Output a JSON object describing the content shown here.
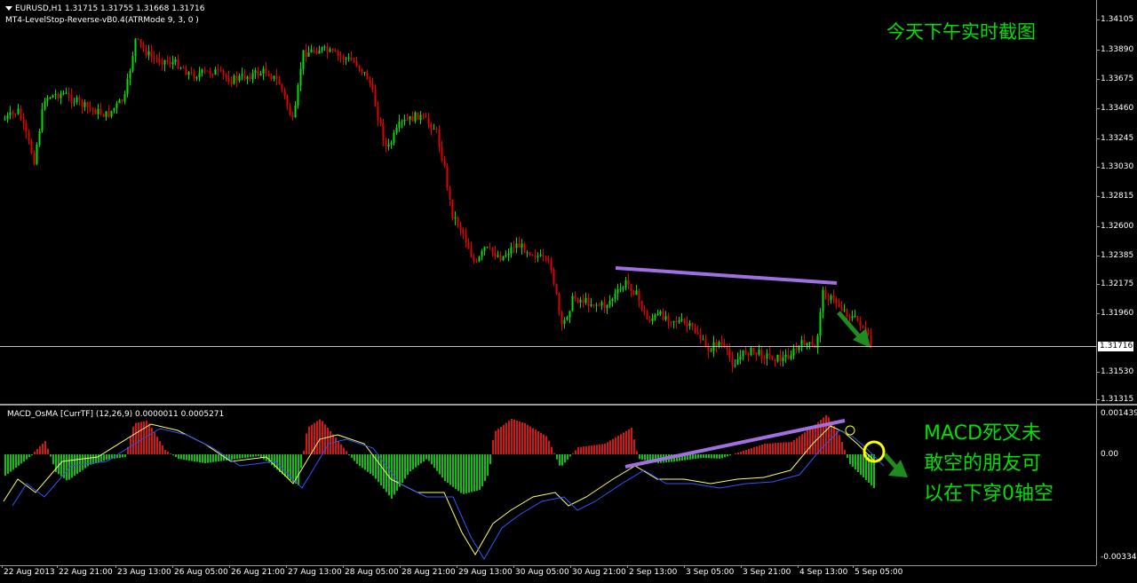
{
  "main": {
    "symbol_line": "EURUSD,H1  1.31715 1.31755 1.31668 1.31716",
    "indicator_line": "MT4-LevelStop-Reverse-vB0.4(ATRMode 9, 3, 0 )",
    "overlay_text": "今天下午实时截图",
    "current_price": "1.31716",
    "price_ticks": [
      "1.34105",
      "1.33890",
      "1.33675",
      "1.33460",
      "1.33245",
      "1.33030",
      "1.32815",
      "1.32600",
      "1.32385",
      "1.32175",
      "1.31960",
      "1.31530",
      "1.31315"
    ]
  },
  "oscillator": {
    "title": "MACD_OsMA [CurrTF] (12,26,9) 0.0000011 0.0005271",
    "ticks": [
      "0.0014391",
      "0.00",
      "-0.0033407"
    ],
    "overlay_lines": [
      "MACD死叉未",
      "敢空的朋友可",
      "以在下穿0轴空"
    ]
  },
  "time_axis": {
    "labels": [
      "22 Aug 2013",
      "22 Aug 21:00",
      "23 Aug 13:00",
      "26 Aug 05:00",
      "26 Aug 21:00",
      "27 Aug 13:00",
      "28 Aug 05:00",
      "28 Aug 21:00",
      "29 Aug 13:00",
      "30 Aug 05:00",
      "30 Aug 21:00",
      "2 Sep 13:00",
      "3 Sep 05:00",
      "3 Sep 21:00",
      "4 Sep 13:00",
      "5 Sep 05:00"
    ]
  },
  "colors": {
    "bull": "#00e000",
    "bear": "#e00000",
    "macd_line": "#ffff66",
    "signal_line": "#3355ff",
    "trendline": "#a070e0",
    "arrow": "#1e8c1e",
    "circle": "#ffff00"
  },
  "icons": {
    "dropdown": "triangle-down-icon"
  }
}
